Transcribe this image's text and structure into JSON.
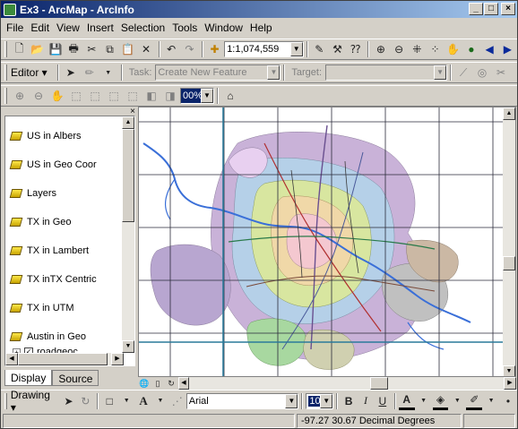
{
  "window": {
    "title": "Ex3 - ArcMap - ArcInfo",
    "min": "_",
    "max": "□",
    "close": "×"
  },
  "menu": [
    "File",
    "Edit",
    "View",
    "Insert",
    "Selection",
    "Tools",
    "Window",
    "Help"
  ],
  "std_toolbar": {
    "scale": "1:1,074,559"
  },
  "editor_toolbar": {
    "editor": "Editor ▾",
    "task_label": "Task:",
    "task_value": "Create New Feature",
    "target_label": "Target:"
  },
  "layout_toolbar": {
    "zoom_value": "00%"
  },
  "toc": {
    "frames": [
      "US in Albers",
      "US in Geo Coor",
      "Layers",
      "TX in Geo",
      "TX in Lambert",
      "TX inTX Centric",
      "TX in UTM",
      "Austin in Geo"
    ],
    "layer": "roadgeoc",
    "tabs": [
      "Display",
      "Source"
    ]
  },
  "draw_toolbar": {
    "drawing": "Drawing ▾",
    "font": "Arial",
    "size": "10",
    "bold": "B",
    "italic": "I",
    "underline": "U"
  },
  "status": {
    "coords": "-97.27  30.67 Decimal Degrees"
  }
}
